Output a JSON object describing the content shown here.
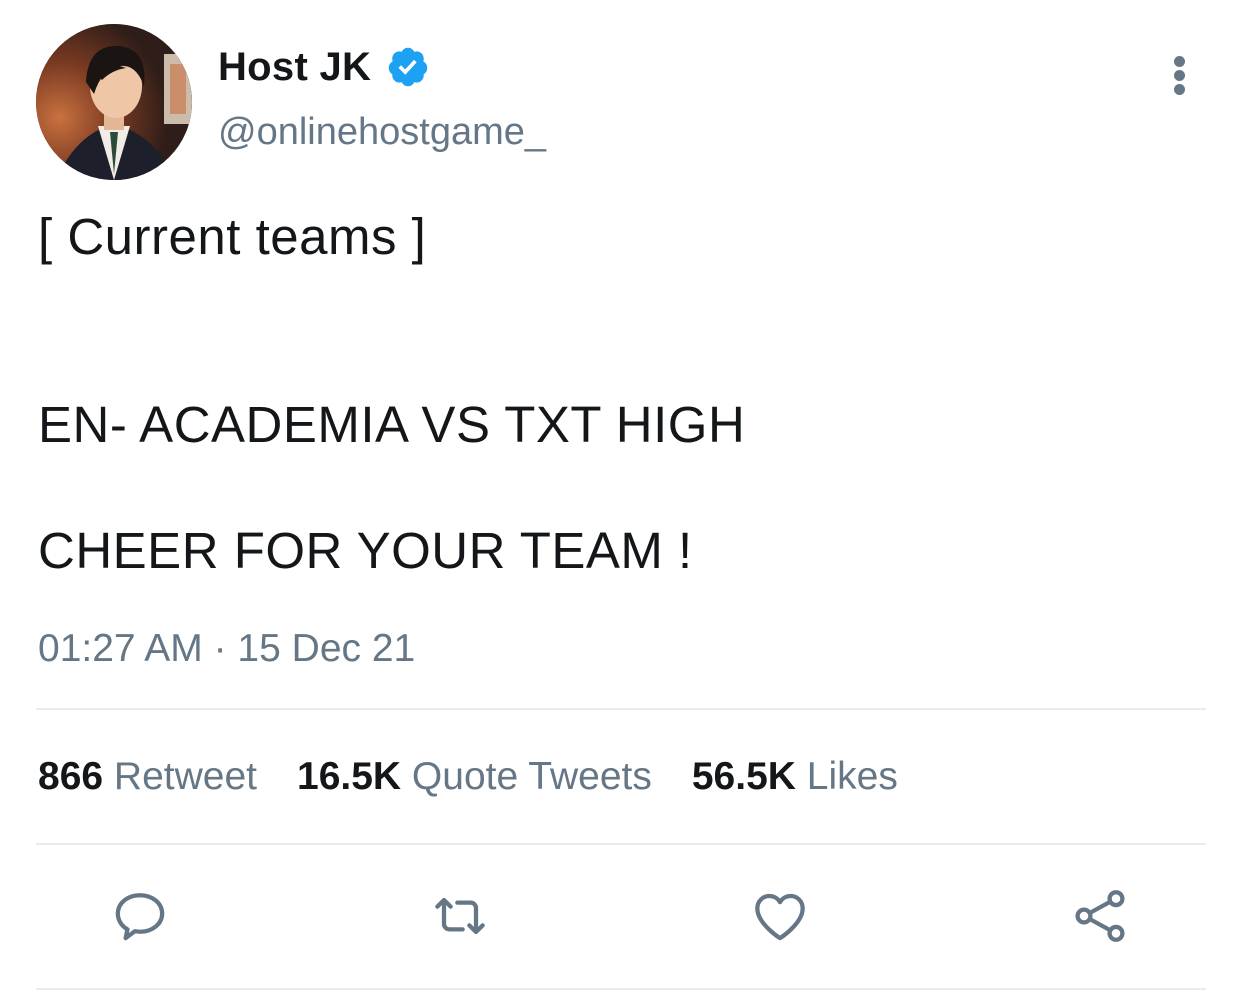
{
  "author": {
    "display_name": "Host JK",
    "handle": "@onlinehostgame_",
    "verified": true
  },
  "tweet": {
    "lines": [
      "[ Current teams ]",
      "EN- ACADEMIA VS TXT HIGH",
      "CHEER FOR YOUR TEAM !"
    ],
    "timestamp": "01:27 AM · 15 Dec 21"
  },
  "stats": [
    {
      "count": "866",
      "label": "Retweet"
    },
    {
      "count": "16.5K",
      "label": "Quote Tweets"
    },
    {
      "count": "56.5K",
      "label": "Likes"
    }
  ],
  "actions": {
    "reply": "reply-icon",
    "retweet": "retweet-icon",
    "like": "heart-icon",
    "share": "share-icon"
  },
  "colors": {
    "verified": "#1da1f2",
    "secondary_text": "#657786",
    "primary_text": "#14171a",
    "divider": "#e6ecf0"
  }
}
